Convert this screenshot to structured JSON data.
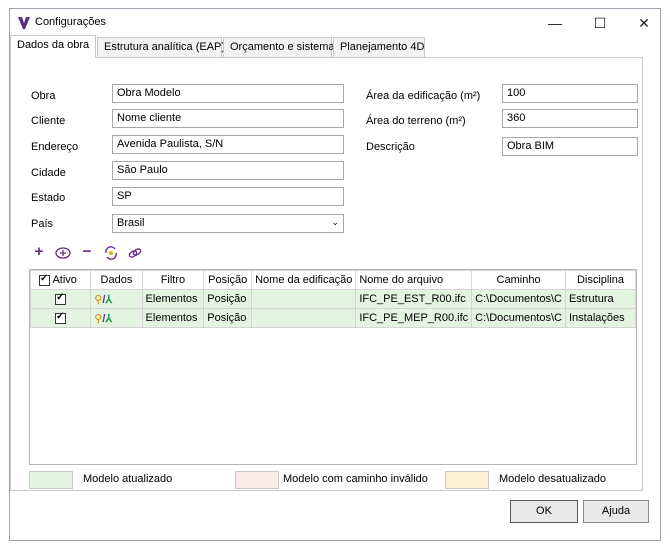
{
  "window": {
    "title": "Configurações",
    "minimize": "—",
    "maximize": "☐",
    "close": "✕"
  },
  "tabs": [
    "Dados da obra",
    "Estrutura analítica (EAP)",
    "Orçamento e sistema",
    "Planejamento 4D"
  ],
  "form": {
    "obra": {
      "label": "Obra",
      "value": "Obra Modelo"
    },
    "cliente": {
      "label": "Cliente",
      "value": "Nome cliente"
    },
    "endereco": {
      "label": "Endereço",
      "value": "Avenida Paulista, S/N"
    },
    "cidade": {
      "label": "Cidade",
      "value": "São Paulo"
    },
    "estado": {
      "label": "Estado",
      "value": "SP"
    },
    "pais": {
      "label": "País",
      "value": "Brasil"
    },
    "area_edificacao": {
      "label": "Área da edificação (m²)",
      "value": "100"
    },
    "area_terreno": {
      "label": "Área do terreno (m²)",
      "value": "360"
    },
    "descricao": {
      "label": "Descrição",
      "value": "Obra BIM"
    }
  },
  "toolbar": [
    "add-icon",
    "add-circle-icon",
    "remove-icon",
    "refresh-icon",
    "link-icon"
  ],
  "grid": {
    "headers": [
      "Ativo",
      "Dados",
      "Filtro",
      "Posição",
      "Nome da edificação",
      "Nome do arquivo",
      "Caminho",
      "Disciplina"
    ],
    "rows": [
      {
        "ativo": true,
        "filtro": "Elementos",
        "posicao": "Posição",
        "nome_edificacao": "",
        "arquivo": "IFC_PE_EST_R00.ifc",
        "caminho": "C:\\Documentos\\C",
        "disciplina": "Estrutura"
      },
      {
        "ativo": true,
        "filtro": "Elementos",
        "posicao": "Posição",
        "nome_edificacao": "",
        "arquivo": "IFC_PE_MEP_R00.ifc",
        "caminho": "C:\\Documentos\\C",
        "disciplina": "Instalações"
      }
    ]
  },
  "legend": [
    {
      "label": "Modelo atualizado",
      "color": "#e3f4e1"
    },
    {
      "label": "Modelo com caminho inválido",
      "color": "#fbeaea"
    },
    {
      "label": "Modelo desatualizado",
      "color": "#fbf0d2"
    }
  ],
  "buttons": {
    "ok": "OK",
    "help": "Ajuda"
  },
  "colors": {
    "accent": "#6a2a8a",
    "row_ok": "#e3f4e1"
  }
}
